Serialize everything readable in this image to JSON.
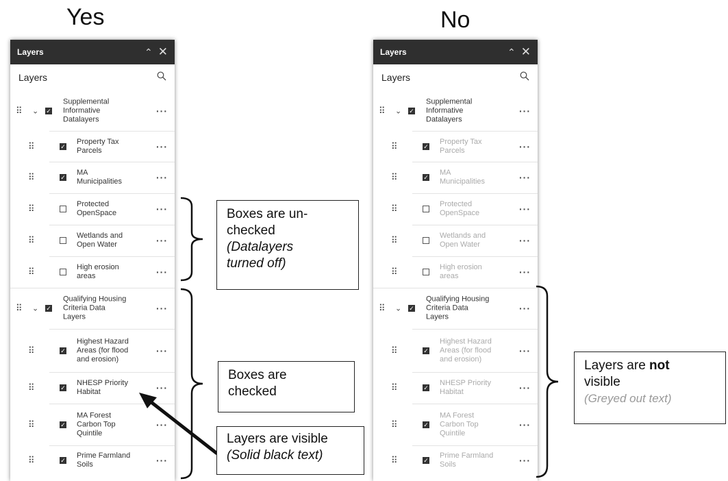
{
  "headings": {
    "left": "Yes",
    "right": "No"
  },
  "panel": {
    "header_title": "Layers",
    "list_title": "Layers",
    "rows": [
      {
        "type": "group",
        "label": [
          "Supplemental",
          "Informative",
          "Datalayers"
        ],
        "checked": true,
        "name": "supplemental-informative-datalayers"
      },
      {
        "type": "layer",
        "label": [
          "Property Tax",
          "Parcels"
        ],
        "checked": true,
        "name": "property-tax-parcels"
      },
      {
        "type": "layer",
        "label": [
          "MA",
          "Municipalities"
        ],
        "checked": true,
        "name": "ma-municipalities"
      },
      {
        "type": "layer",
        "label": [
          "Protected",
          "OpenSpace"
        ],
        "checked": false,
        "name": "protected-openspace"
      },
      {
        "type": "layer",
        "label": [
          "Wetlands and",
          "Open Water"
        ],
        "checked": false,
        "name": "wetlands-open-water"
      },
      {
        "type": "layer",
        "label": [
          "High erosion",
          "areas"
        ],
        "checked": false,
        "name": "high-erosion-areas"
      },
      {
        "type": "group",
        "label": [
          "Qualifying Housing",
          "Criteria Data",
          "Layers"
        ],
        "checked": true,
        "name": "qualifying-housing-criteria"
      },
      {
        "type": "layer",
        "label": [
          "Highest Hazard",
          "Areas (for flood",
          "and erosion)"
        ],
        "checked": true,
        "name": "highest-hazard-areas"
      },
      {
        "type": "layer",
        "label": [
          "NHESP Priority",
          "Habitat"
        ],
        "checked": true,
        "name": "nhesp-priority-habitat"
      },
      {
        "type": "layer",
        "label": [
          "MA Forest",
          "Carbon Top",
          "Quintile"
        ],
        "checked": true,
        "name": "ma-forest-carbon"
      },
      {
        "type": "layer",
        "label": [
          "Prime Farmland",
          "Soils"
        ],
        "checked": true,
        "name": "prime-farmland-soils"
      }
    ]
  },
  "icons": {
    "collapse": "double-chevron-up-icon",
    "close": "close-icon",
    "search": "search-icon",
    "drag": "drag-handle-icon",
    "expand": "chevron-down-icon",
    "more": "more-options-icon"
  },
  "colors": {
    "header_bg": "#2f2f2f",
    "grey_text": "#aaaaaa",
    "black_text": "#333333"
  },
  "callouts": {
    "unchecked": {
      "line1": "Boxes are un-",
      "line2": "checked",
      "note1": "(Datalayers",
      "note2": "turned off)"
    },
    "checked": {
      "line1": "Boxes are",
      "line2": "checked"
    },
    "visible": {
      "line1": "Layers are visible",
      "note": "(Solid black text)"
    },
    "not_visible": {
      "prefix": "Layers are ",
      "bold": "not",
      "line2": "visible",
      "note": "(Greyed out text)"
    }
  }
}
